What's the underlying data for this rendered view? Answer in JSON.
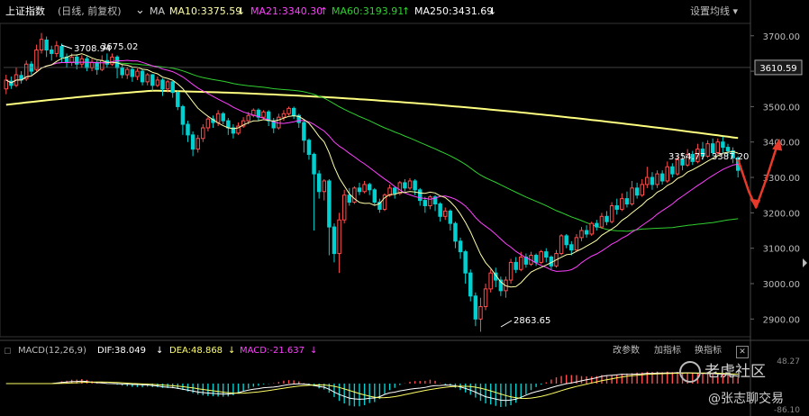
{
  "header": {
    "index_name": "上证指数",
    "period_info": "(日线, 前复权)",
    "ma_prefix": "MA",
    "ma10": "MA10:3375.59",
    "ma21": "MA21:3340.30",
    "ma60": "MA60:3193.91",
    "ma250": "MA250:3431.69",
    "ma_settings": "设置均线",
    "ma10_arrow": "↓",
    "ma21_arrow": "↑",
    "ma60_arrow": "↑",
    "ma250_arrow": "↓"
  },
  "macd_header": {
    "label": "MACD(12,26,9)",
    "dif": "DIF:38.049",
    "dif_arrow": "↓",
    "dea": "DEA:48.868",
    "dea_arrow": "↓",
    "macd": "MACD:-21.637",
    "macd_arrow": "↓",
    "change_params": "改参数",
    "add_indicator": "加指标",
    "switch_indicator": "换指标",
    "close": "✕"
  },
  "watermark": {
    "brand": "老虎社区",
    "author": "@张志聊交易"
  },
  "colors": {
    "up": "#ff4d4d",
    "down": "#00d0d0",
    "ma10": "#ffffaa",
    "ma21": "#ff40ff",
    "ma60": "#30d030",
    "ma250": "#ffff80",
    "arrow": "#e83a2a"
  },
  "chart_data": {
    "type": "candlestick",
    "y_axis_ticks": [
      "3700.00",
      "3600.00",
      "3500.00",
      "3400.00",
      "3300.00",
      "3200.00",
      "3100.00",
      "3000.00",
      "2900.00"
    ],
    "ylim": [
      2855,
      3735
    ],
    "last_price_label": "3610.59",
    "annotations": {
      "high": "3708.94",
      "high_prefix": "3675.02",
      "low": "2863.65",
      "right": "3354.77",
      "right_suffix": "3387.20"
    },
    "macd_axis_labels": [
      "48.27",
      "-86.10"
    ],
    "candles": [
      {
        "o": 3550,
        "c": 3575,
        "h": 3590,
        "l": 3535
      },
      {
        "o": 3572,
        "c": 3560,
        "h": 3585,
        "l": 3550
      },
      {
        "o": 3560,
        "c": 3590,
        "h": 3610,
        "l": 3555
      },
      {
        "o": 3588,
        "c": 3575,
        "h": 3600,
        "l": 3565
      },
      {
        "o": 3578,
        "c": 3620,
        "h": 3630,
        "l": 3572
      },
      {
        "o": 3620,
        "c": 3600,
        "h": 3628,
        "l": 3590
      },
      {
        "o": 3605,
        "c": 3660,
        "h": 3675,
        "l": 3600
      },
      {
        "o": 3660,
        "c": 3690,
        "h": 3708,
        "l": 3650
      },
      {
        "o": 3688,
        "c": 3660,
        "h": 3698,
        "l": 3640
      },
      {
        "o": 3660,
        "c": 3650,
        "h": 3672,
        "l": 3630
      },
      {
        "o": 3650,
        "c": 3672,
        "h": 3685,
        "l": 3640
      },
      {
        "o": 3670,
        "c": 3640,
        "h": 3678,
        "l": 3625
      },
      {
        "o": 3640,
        "c": 3625,
        "h": 3650,
        "l": 3610
      },
      {
        "o": 3625,
        "c": 3640,
        "h": 3650,
        "l": 3615
      },
      {
        "o": 3640,
        "c": 3620,
        "h": 3648,
        "l": 3605
      },
      {
        "o": 3620,
        "c": 3635,
        "h": 3645,
        "l": 3610
      },
      {
        "o": 3635,
        "c": 3610,
        "h": 3642,
        "l": 3600
      },
      {
        "o": 3610,
        "c": 3625,
        "h": 3635,
        "l": 3600
      },
      {
        "o": 3625,
        "c": 3605,
        "h": 3630,
        "l": 3590
      },
      {
        "o": 3605,
        "c": 3630,
        "h": 3645,
        "l": 3600
      },
      {
        "o": 3630,
        "c": 3620,
        "h": 3650,
        "l": 3610
      },
      {
        "o": 3620,
        "c": 3640,
        "h": 3650,
        "l": 3615
      },
      {
        "o": 3640,
        "c": 3610,
        "h": 3645,
        "l": 3580
      },
      {
        "o": 3610,
        "c": 3590,
        "h": 3620,
        "l": 3580
      },
      {
        "o": 3590,
        "c": 3605,
        "h": 3612,
        "l": 3578
      },
      {
        "o": 3605,
        "c": 3585,
        "h": 3610,
        "l": 3570
      },
      {
        "o": 3585,
        "c": 3600,
        "h": 3608,
        "l": 3575
      },
      {
        "o": 3600,
        "c": 3570,
        "h": 3605,
        "l": 3560
      },
      {
        "o": 3570,
        "c": 3590,
        "h": 3595,
        "l": 3560
      },
      {
        "o": 3590,
        "c": 3560,
        "h": 3592,
        "l": 3545
      },
      {
        "o": 3560,
        "c": 3575,
        "h": 3585,
        "l": 3555
      },
      {
        "o": 3575,
        "c": 3550,
        "h": 3580,
        "l": 3530
      },
      {
        "o": 3550,
        "c": 3570,
        "h": 3575,
        "l": 3540
      },
      {
        "o": 3570,
        "c": 3540,
        "h": 3572,
        "l": 3525
      },
      {
        "o": 3540,
        "c": 3500,
        "h": 3545,
        "l": 3490
      },
      {
        "o": 3500,
        "c": 3450,
        "h": 3505,
        "l": 3420
      },
      {
        "o": 3450,
        "c": 3420,
        "h": 3460,
        "l": 3400
      },
      {
        "o": 3420,
        "c": 3380,
        "h": 3430,
        "l": 3360
      },
      {
        "o": 3380,
        "c": 3410,
        "h": 3420,
        "l": 3370
      },
      {
        "o": 3410,
        "c": 3440,
        "h": 3450,
        "l": 3400
      },
      {
        "o": 3440,
        "c": 3465,
        "h": 3470,
        "l": 3430
      },
      {
        "o": 3465,
        "c": 3455,
        "h": 3475,
        "l": 3440
      },
      {
        "o": 3455,
        "c": 3480,
        "h": 3490,
        "l": 3445
      },
      {
        "o": 3480,
        "c": 3460,
        "h": 3485,
        "l": 3450
      },
      {
        "o": 3460,
        "c": 3440,
        "h": 3468,
        "l": 3420
      },
      {
        "o": 3440,
        "c": 3425,
        "h": 3450,
        "l": 3410
      },
      {
        "o": 3425,
        "c": 3445,
        "h": 3455,
        "l": 3420
      },
      {
        "o": 3445,
        "c": 3460,
        "h": 3470,
        "l": 3440
      },
      {
        "o": 3460,
        "c": 3475,
        "h": 3485,
        "l": 3450
      },
      {
        "o": 3475,
        "c": 3490,
        "h": 3495,
        "l": 3470
      },
      {
        "o": 3490,
        "c": 3470,
        "h": 3495,
        "l": 3460
      },
      {
        "o": 3470,
        "c": 3485,
        "h": 3490,
        "l": 3465
      },
      {
        "o": 3485,
        "c": 3460,
        "h": 3490,
        "l": 3445
      },
      {
        "o": 3460,
        "c": 3440,
        "h": 3468,
        "l": 3425
      },
      {
        "o": 3440,
        "c": 3470,
        "h": 3480,
        "l": 3435
      },
      {
        "o": 3470,
        "c": 3480,
        "h": 3490,
        "l": 3460
      },
      {
        "o": 3480,
        "c": 3495,
        "h": 3500,
        "l": 3475
      },
      {
        "o": 3495,
        "c": 3475,
        "h": 3500,
        "l": 3465
      },
      {
        "o": 3475,
        "c": 3455,
        "h": 3480,
        "l": 3440
      },
      {
        "o": 3455,
        "c": 3405,
        "h": 3460,
        "l": 3370
      },
      {
        "o": 3405,
        "c": 3365,
        "h": 3410,
        "l": 3350
      },
      {
        "o": 3365,
        "c": 3310,
        "h": 3370,
        "l": 3150
      },
      {
        "o": 3310,
        "c": 3260,
        "h": 3320,
        "l": 3240
      },
      {
        "o": 3260,
        "c": 3290,
        "h": 3295,
        "l": 3235
      },
      {
        "o": 3290,
        "c": 3160,
        "h": 3295,
        "l": 3080
      },
      {
        "o": 3160,
        "c": 3085,
        "h": 3170,
        "l": 3060
      },
      {
        "o": 3085,
        "c": 3180,
        "h": 3200,
        "l": 3030
      },
      {
        "o": 3180,
        "c": 3250,
        "h": 3265,
        "l": 3170
      },
      {
        "o": 3250,
        "c": 3230,
        "h": 3270,
        "l": 3220
      },
      {
        "o": 3230,
        "c": 3270,
        "h": 3275,
        "l": 3225
      },
      {
        "o": 3270,
        "c": 3260,
        "h": 3285,
        "l": 3250
      },
      {
        "o": 3260,
        "c": 3280,
        "h": 3290,
        "l": 3255
      },
      {
        "o": 3280,
        "c": 3265,
        "h": 3285,
        "l": 3250
      },
      {
        "o": 3265,
        "c": 3230,
        "h": 3270,
        "l": 3220
      },
      {
        "o": 3230,
        "c": 3210,
        "h": 3240,
        "l": 3200
      },
      {
        "o": 3210,
        "c": 3250,
        "h": 3255,
        "l": 3205
      },
      {
        "o": 3250,
        "c": 3270,
        "h": 3280,
        "l": 3245
      },
      {
        "o": 3270,
        "c": 3255,
        "h": 3275,
        "l": 3240
      },
      {
        "o": 3255,
        "c": 3285,
        "h": 3290,
        "l": 3250
      },
      {
        "o": 3285,
        "c": 3270,
        "h": 3295,
        "l": 3260
      },
      {
        "o": 3270,
        "c": 3290,
        "h": 3298,
        "l": 3265
      },
      {
        "o": 3290,
        "c": 3265,
        "h": 3295,
        "l": 3250
      },
      {
        "o": 3265,
        "c": 3235,
        "h": 3270,
        "l": 3220
      },
      {
        "o": 3235,
        "c": 3220,
        "h": 3245,
        "l": 3200
      },
      {
        "o": 3220,
        "c": 3245,
        "h": 3250,
        "l": 3210
      },
      {
        "o": 3245,
        "c": 3225,
        "h": 3250,
        "l": 3205
      },
      {
        "o": 3225,
        "c": 3190,
        "h": 3230,
        "l": 3175
      },
      {
        "o": 3190,
        "c": 3205,
        "h": 3215,
        "l": 3180
      },
      {
        "o": 3205,
        "c": 3170,
        "h": 3210,
        "l": 3150
      },
      {
        "o": 3170,
        "c": 3120,
        "h": 3175,
        "l": 3100
      },
      {
        "o": 3120,
        "c": 3090,
        "h": 3130,
        "l": 3070
      },
      {
        "o": 3090,
        "c": 3030,
        "h": 3095,
        "l": 3000
      },
      {
        "o": 3030,
        "c": 2965,
        "h": 3040,
        "l": 2950
      },
      {
        "o": 2965,
        "c": 2900,
        "h": 2975,
        "l": 2880
      },
      {
        "o": 2900,
        "c": 2935,
        "h": 2960,
        "l": 2864
      },
      {
        "o": 2935,
        "c": 2985,
        "h": 3000,
        "l": 2925
      },
      {
        "o": 2985,
        "c": 3030,
        "h": 3040,
        "l": 2975
      },
      {
        "o": 3030,
        "c": 3010,
        "h": 3045,
        "l": 2990
      },
      {
        "o": 3010,
        "c": 2980,
        "h": 3020,
        "l": 2965
      },
      {
        "o": 2980,
        "c": 3010,
        "h": 3020,
        "l": 2960
      },
      {
        "o": 3010,
        "c": 3060,
        "h": 3070,
        "l": 3000
      },
      {
        "o": 3060,
        "c": 3040,
        "h": 3075,
        "l": 3030
      },
      {
        "o": 3040,
        "c": 3075,
        "h": 3090,
        "l": 3035
      },
      {
        "o": 3075,
        "c": 3055,
        "h": 3085,
        "l": 3045
      },
      {
        "o": 3055,
        "c": 3080,
        "h": 3090,
        "l": 3050
      },
      {
        "o": 3080,
        "c": 3060,
        "h": 3085,
        "l": 3050
      },
      {
        "o": 3060,
        "c": 3090,
        "h": 3095,
        "l": 3055
      },
      {
        "o": 3090,
        "c": 3075,
        "h": 3100,
        "l": 3060
      },
      {
        "o": 3075,
        "c": 3050,
        "h": 3080,
        "l": 3040
      },
      {
        "o": 3050,
        "c": 3085,
        "h": 3095,
        "l": 3045
      },
      {
        "o": 3085,
        "c": 3135,
        "h": 3140,
        "l": 3080
      },
      {
        "o": 3135,
        "c": 3110,
        "h": 3140,
        "l": 3100
      },
      {
        "o": 3110,
        "c": 3095,
        "h": 3120,
        "l": 3080
      },
      {
        "o": 3095,
        "c": 3130,
        "h": 3140,
        "l": 3090
      },
      {
        "o": 3130,
        "c": 3150,
        "h": 3160,
        "l": 3120
      },
      {
        "o": 3150,
        "c": 3140,
        "h": 3165,
        "l": 3130
      },
      {
        "o": 3140,
        "c": 3170,
        "h": 3175,
        "l": 3135
      },
      {
        "o": 3170,
        "c": 3160,
        "h": 3180,
        "l": 3150
      },
      {
        "o": 3160,
        "c": 3190,
        "h": 3200,
        "l": 3155
      },
      {
        "o": 3190,
        "c": 3175,
        "h": 3205,
        "l": 3165
      },
      {
        "o": 3175,
        "c": 3220,
        "h": 3230,
        "l": 3170
      },
      {
        "o": 3220,
        "c": 3210,
        "h": 3240,
        "l": 3195
      },
      {
        "o": 3210,
        "c": 3240,
        "h": 3255,
        "l": 3205
      },
      {
        "o": 3240,
        "c": 3225,
        "h": 3260,
        "l": 3215
      },
      {
        "o": 3225,
        "c": 3270,
        "h": 3290,
        "l": 3220
      },
      {
        "o": 3270,
        "c": 3250,
        "h": 3285,
        "l": 3240
      },
      {
        "o": 3250,
        "c": 3280,
        "h": 3295,
        "l": 3245
      },
      {
        "o": 3280,
        "c": 3300,
        "h": 3330,
        "l": 3270
      },
      {
        "o": 3300,
        "c": 3280,
        "h": 3315,
        "l": 3265
      },
      {
        "o": 3280,
        "c": 3310,
        "h": 3320,
        "l": 3270
      },
      {
        "o": 3310,
        "c": 3290,
        "h": 3320,
        "l": 3280
      },
      {
        "o": 3290,
        "c": 3330,
        "h": 3345,
        "l": 3285
      },
      {
        "o": 3330,
        "c": 3310,
        "h": 3340,
        "l": 3300
      },
      {
        "o": 3310,
        "c": 3350,
        "h": 3360,
        "l": 3305
      },
      {
        "o": 3350,
        "c": 3335,
        "h": 3370,
        "l": 3320
      },
      {
        "o": 3335,
        "c": 3365,
        "h": 3380,
        "l": 3330
      },
      {
        "o": 3365,
        "c": 3345,
        "h": 3375,
        "l": 3335
      },
      {
        "o": 3345,
        "c": 3380,
        "h": 3395,
        "l": 3340
      },
      {
        "o": 3380,
        "c": 3360,
        "h": 3400,
        "l": 3350
      },
      {
        "o": 3360,
        "c": 3395,
        "h": 3405,
        "l": 3355
      },
      {
        "o": 3395,
        "c": 3370,
        "h": 3410,
        "l": 3360
      },
      {
        "o": 3370,
        "c": 3400,
        "h": 3410,
        "l": 3365
      },
      {
        "o": 3400,
        "c": 3385,
        "h": 3415,
        "l": 3370
      },
      {
        "o": 3385,
        "c": 3375,
        "h": 3395,
        "l": 3360
      },
      {
        "o": 3375,
        "c": 3355,
        "h": 3385,
        "l": 3340
      },
      {
        "o": 3355,
        "c": 3320,
        "h": 3360,
        "l": 3300
      }
    ]
  }
}
